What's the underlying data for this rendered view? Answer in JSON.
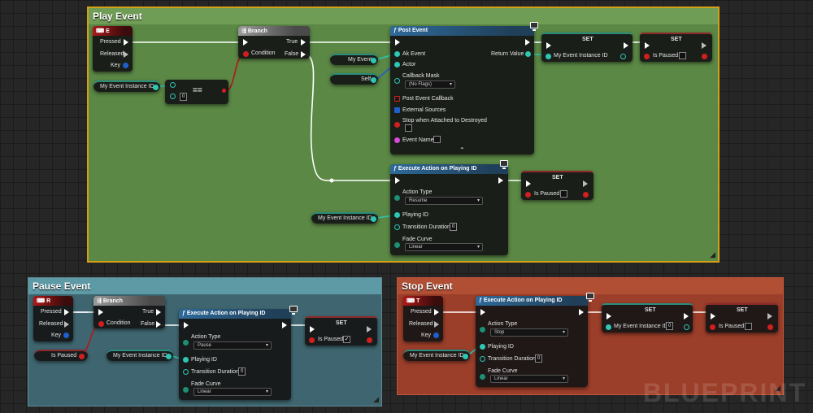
{
  "comments": {
    "play": "Play Event",
    "pause": "Pause Event",
    "stop": "Stop Event"
  },
  "watermark": "BLUEPRINT",
  "play": {
    "key_e": {
      "title": "E",
      "pressed": "Pressed",
      "released": "Released",
      "key": "Key"
    },
    "branch": {
      "title": "Branch",
      "condition": "Condition",
      "true": "True",
      "false": "False"
    },
    "var_instance": "My Event Instance ID",
    "equals": {
      "op": "==",
      "value": "0"
    },
    "var_my_event": "My Event",
    "var_self": "Self",
    "post_event": {
      "title": "Post Event",
      "ak_event": "Ak Event",
      "actor": "Actor",
      "callback_mask": "Callback Mask",
      "callback_mask_value": "(No Flags)",
      "post_event_callback": "Post Event Callback",
      "external_sources": "External Sources",
      "stop_when_destroyed": "Stop when Attached to Destroyed",
      "event_name": "Event Name",
      "return_value": "Return Value"
    },
    "set1": {
      "title": "SET",
      "label": "My Event Instance ID"
    },
    "set2": {
      "title": "SET",
      "label": "Is Paused"
    },
    "exec_action": {
      "title": "Execute Action on Playing ID",
      "action_type": "Action Type",
      "action_value": "Resume",
      "playing_id": "Playing ID",
      "transition": "Transition Duration",
      "transition_value": "0",
      "fade_curve": "Fade Curve",
      "fade_value": "Linear"
    },
    "set3": {
      "title": "SET",
      "label": "Is Paused"
    },
    "var_instance2": "My Event Instance ID"
  },
  "pause": {
    "key_r": {
      "title": "R",
      "pressed": "Pressed",
      "released": "Released",
      "key": "Key"
    },
    "branch": {
      "title": "Branch",
      "condition": "Condition",
      "true": "True",
      "false": "False"
    },
    "var_paused": "Is Paused",
    "var_instance": "My Event Instance ID",
    "exec_action": {
      "title": "Execute Action on Playing ID",
      "action_type": "Action Type",
      "action_value": "Pause",
      "playing_id": "Playing ID",
      "transition": "Transition Duration",
      "transition_value": "0",
      "fade_curve": "Fade Curve",
      "fade_value": "Linear"
    },
    "set": {
      "title": "SET",
      "label": "Is Paused",
      "checked": "✓"
    }
  },
  "stop": {
    "key_t": {
      "title": "T",
      "pressed": "Pressed",
      "released": "Released",
      "key": "Key"
    },
    "var_instance": "My Event Instance ID",
    "exec_action": {
      "title": "Execute Action on Playing ID",
      "action_type": "Action Type",
      "action_value": "Stop",
      "playing_id": "Playing ID",
      "transition": "Transition Duration",
      "transition_value": "0",
      "fade_curve": "Fade Curve",
      "fade_value": "Linear"
    },
    "set1": {
      "title": "SET",
      "label": "My Event Instance ID",
      "value": "0"
    },
    "set2": {
      "title": "SET",
      "label": "Is Paused"
    }
  },
  "colors": {
    "exec": "#ffffff",
    "integer": "#2dc7b2",
    "boolean": "#d11f1f",
    "object": "#1f5fcc",
    "string": "#d64bd6"
  }
}
